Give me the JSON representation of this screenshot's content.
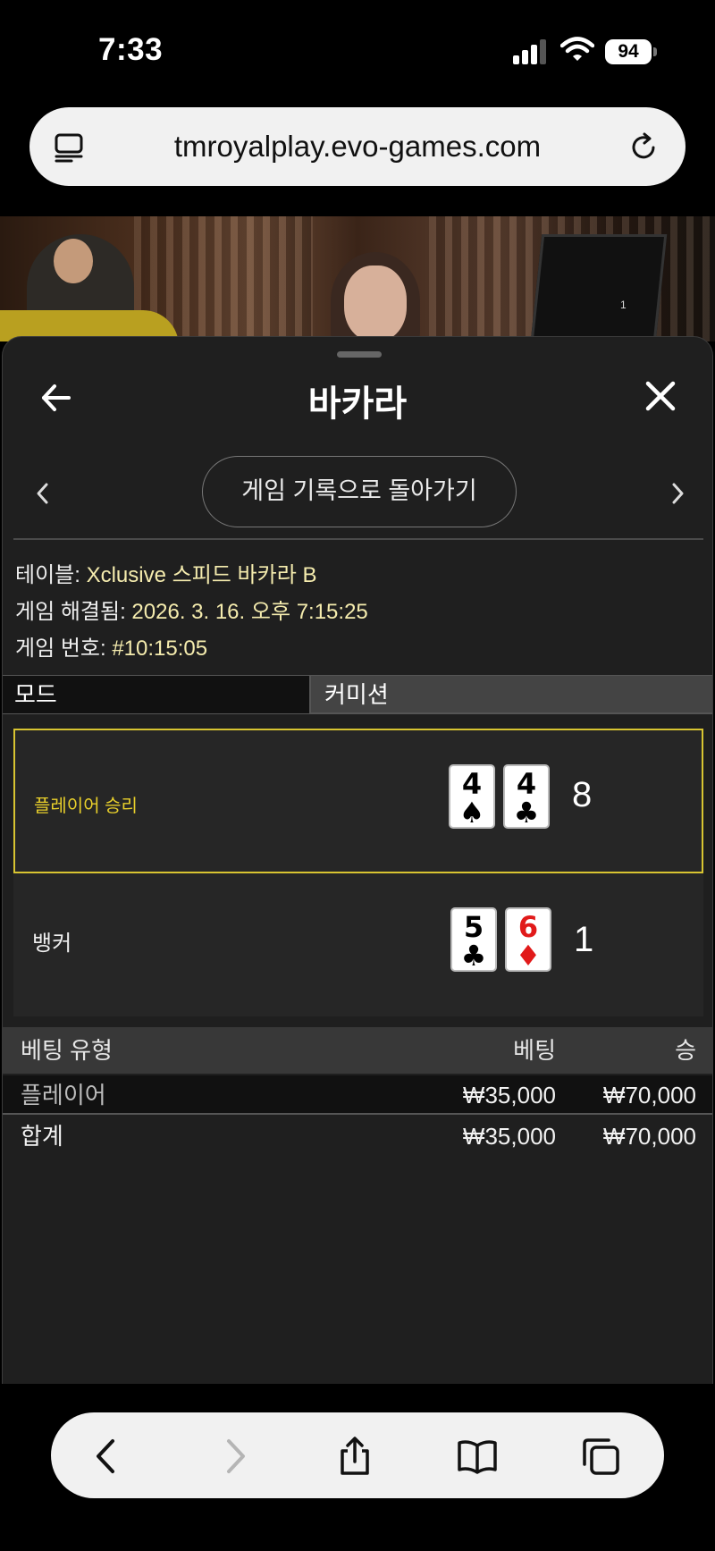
{
  "status_bar": {
    "time": "7:33",
    "battery": "94"
  },
  "browser": {
    "url": "tmroyalplay.evo-games.com"
  },
  "video": {
    "monitor_label": "1"
  },
  "sheet": {
    "title": "바카라",
    "history_button": "게임 기록으로 돌아가기",
    "info": {
      "table_label": "테이블:",
      "table_value": "Xclusive 스피드 바카라 B",
      "resolved_label": "게임 해결됨:",
      "resolved_value": "2026. 3. 16. 오후 7:15:25",
      "round_label": "게임 번호:",
      "round_value": "#10:15:05"
    },
    "mode": {
      "label": "모드",
      "value": "커미션"
    },
    "outcomes": {
      "player": {
        "label": "플레이어 승리",
        "cards": [
          {
            "rank": "4",
            "suit": "♠"
          },
          {
            "rank": "4",
            "suit": "♣"
          }
        ],
        "score": "8"
      },
      "banker": {
        "label": "뱅커",
        "cards": [
          {
            "rank": "5",
            "suit": "♣"
          },
          {
            "rank": "6",
            "suit": "♦"
          }
        ],
        "score": "1"
      }
    },
    "bets": {
      "headers": {
        "type": "베팅 유형",
        "bet": "베팅",
        "win": "승"
      },
      "rows": [
        {
          "type": "플레이어",
          "bet": "₩35,000",
          "win": "₩70,000"
        }
      ],
      "total": {
        "type": "합계",
        "bet": "₩35,000",
        "win": "₩70,000"
      }
    }
  },
  "colors": {
    "highlight": "#d8c431",
    "info_value": "#f5ecae",
    "red_suit": "#e11a1a"
  }
}
